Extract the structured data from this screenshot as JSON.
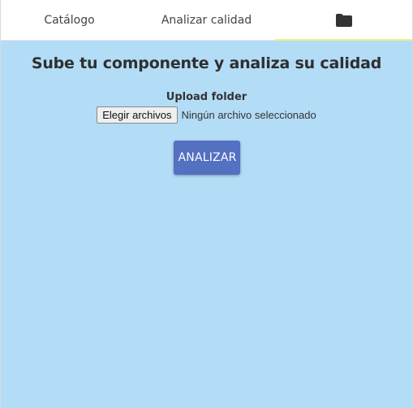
{
  "tabs": [
    {
      "label": "Catálogo"
    },
    {
      "label": "Analizar calidad"
    },
    {
      "icon": "folder-icon",
      "active": true
    }
  ],
  "colors": {
    "background": "#b3dcf7",
    "active_tab_indicator": "#f5ef7a",
    "analyze_button": "#5470c1"
  },
  "main": {
    "title": "Sube tu componente y analiza su calidad",
    "upload_label": "Upload folder",
    "file_button_label": "Elegir archivos",
    "file_status": "Ningún archivo seleccionado",
    "analyze_label": "ANALIZAR"
  }
}
